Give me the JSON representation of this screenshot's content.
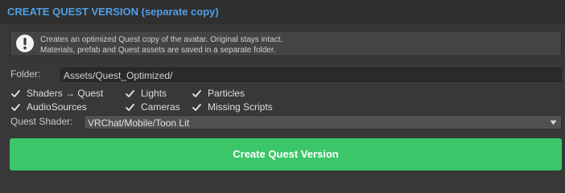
{
  "header": {
    "title": "CREATE QUEST VERSION (separate copy)"
  },
  "help": {
    "icon": "warning-exclamation-icon",
    "line1": "Creates an optimized Quest copy of the avatar. Original stays intact.",
    "line2": "Materials, prefab and Quest assets are saved in a separate folder."
  },
  "folder": {
    "label": "Folder:",
    "value": "Assets/Quest_Optimized/"
  },
  "options": [
    {
      "label": "Shaders → Quest",
      "checked": true
    },
    {
      "label": "Lights",
      "checked": true
    },
    {
      "label": "Particles",
      "checked": true
    },
    {
      "label": "AudioSources",
      "checked": true
    },
    {
      "label": "Cameras",
      "checked": true
    },
    {
      "label": "Missing Scripts",
      "checked": true
    }
  ],
  "shader": {
    "label": "Quest Shader:",
    "selected": "VRChat/Mobile/Toon Lit"
  },
  "actions": {
    "create_label": "Create Quest Version"
  },
  "colors": {
    "header_text": "#4f9fe6",
    "button": "#3cc66a"
  }
}
